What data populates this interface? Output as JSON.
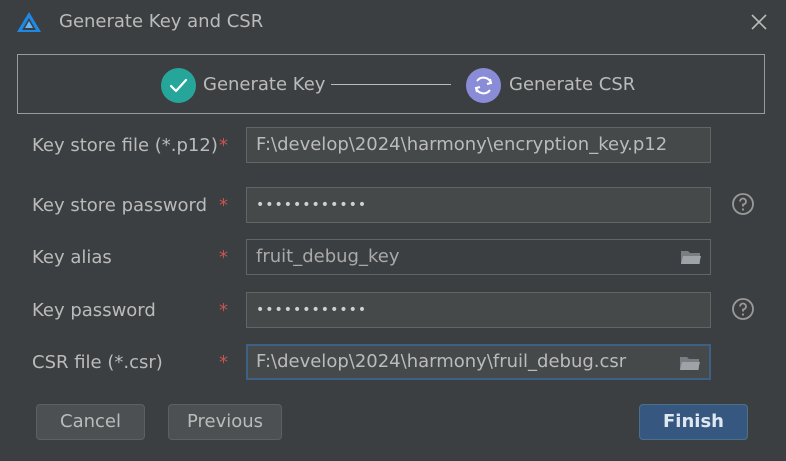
{
  "window": {
    "title": "Generate Key and CSR",
    "logo_icon": "harmony-deveco-logo-icon",
    "close_icon": "close-icon"
  },
  "steps": [
    {
      "label": "Generate Key",
      "status": "completed",
      "icon": "check-icon",
      "color": "#26a69a"
    },
    {
      "label": "Generate CSR",
      "status": "current",
      "icon": "refresh-icon",
      "color": "#8a8cd8"
    }
  ],
  "form": {
    "key_store_file": {
      "label": "Key store file (*.p12)",
      "required_mark": "*",
      "value": "F:\\develop\\2024\\harmony\\encryption_key.p12"
    },
    "key_store_password": {
      "label": "Key store password",
      "required_mark": "*",
      "value": "••••••••••••",
      "help_icon": "question-icon"
    },
    "key_alias": {
      "label": "Key alias",
      "required_mark": "*",
      "value": "fruit_debug_key",
      "browse_icon": "folder-icon"
    },
    "key_password": {
      "label": "Key password",
      "required_mark": "*",
      "value": "••••••••••••",
      "help_icon": "question-icon"
    },
    "csr_file": {
      "label": "CSR file (*.csr)",
      "required_mark": "*",
      "value": "F:\\develop\\2024\\harmony\\fruil_debug.csr",
      "browse_icon": "folder-icon"
    }
  },
  "buttons": {
    "cancel": "Cancel",
    "previous": "Previous",
    "finish": "Finish"
  },
  "colors": {
    "background": "#3c3f41",
    "required": "#c75450",
    "primary_button": "#365880",
    "focus_border": "#3d6185"
  }
}
